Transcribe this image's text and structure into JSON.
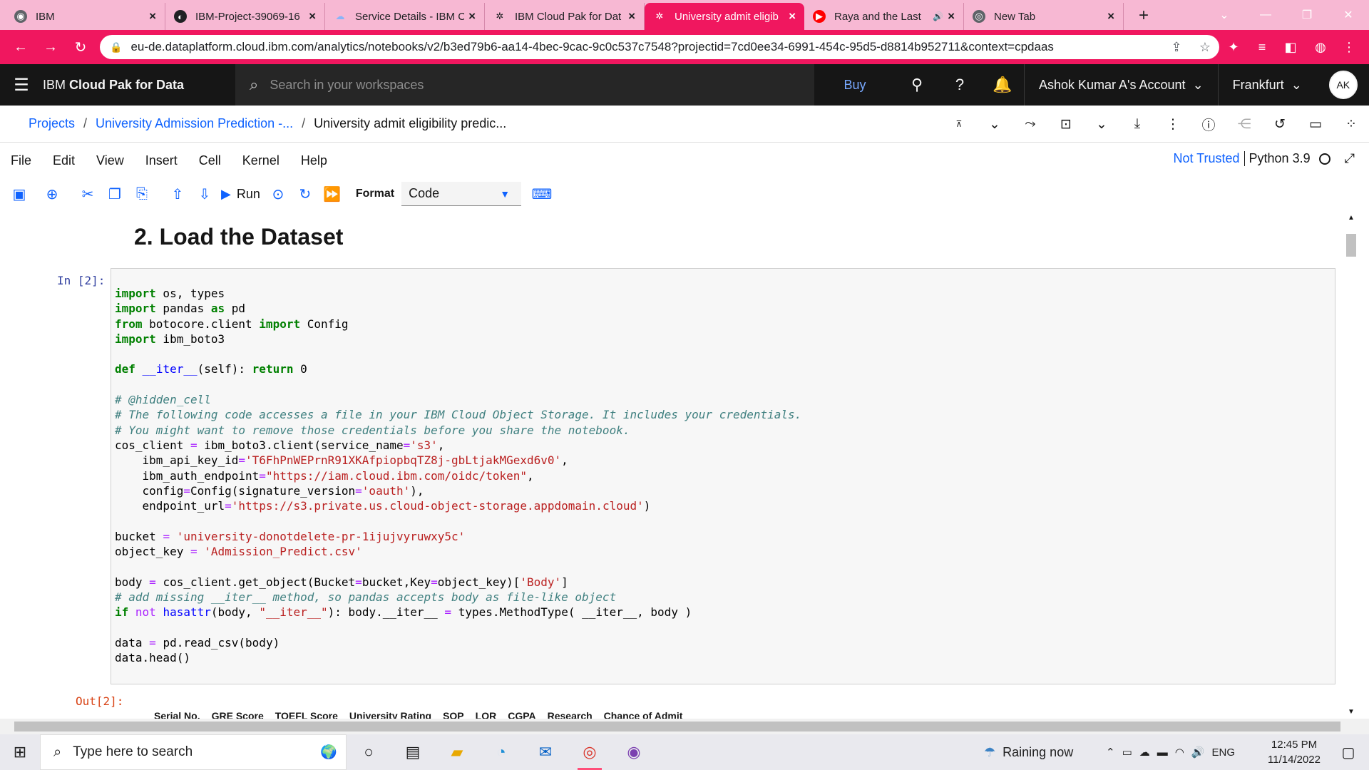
{
  "browser": {
    "tabs": [
      {
        "title": "IBM",
        "icon": "globe-icon",
        "glyph": "◉",
        "fav_bg": "#5f6368",
        "fav_fg": "#ffffff"
      },
      {
        "title": "IBM-Project-39069-16",
        "icon": "github-icon",
        "glyph": "◐",
        "fav_bg": "#202124",
        "fav_fg": "#ffffff"
      },
      {
        "title": "Service Details - IBM C",
        "icon": "cloud-icon",
        "glyph": "☁",
        "fav_bg": "transparent",
        "fav_fg": "#8ab4f8"
      },
      {
        "title": "IBM Cloud Pak for Dat",
        "icon": "ibm-cloudpak-icon",
        "glyph": "✲",
        "fav_bg": "transparent",
        "fav_fg": "#202124"
      },
      {
        "title": "University admit eligib",
        "icon": "ibm-cloudpak-icon",
        "glyph": "✲",
        "fav_bg": "transparent",
        "fav_fg": "#ffffff",
        "active": true
      },
      {
        "title": "Raya and the Last",
        "icon": "youtube-icon",
        "glyph": "▶",
        "fav_bg": "#ff0000",
        "fav_fg": "#ffffff",
        "audio": true
      },
      {
        "title": "New Tab",
        "icon": "chrome-icon",
        "glyph": "◎",
        "fav_bg": "#5f6368",
        "fav_fg": "#ffffff"
      }
    ],
    "url": "eu-de.dataplatform.cloud.ibm.com/analytics/notebooks/v2/b3ed79b6-aa14-4bec-9cac-9c0c537c7548?projectid=7cd0ee34-6991-454c-95d5-d8814b952711&context=cpdaas",
    "accent": "#f0175f",
    "tabstrip_color": "#f7b8d3"
  },
  "header": {
    "brand_prefix": "IBM",
    "brand_name": "Cloud Pak for Data",
    "search_placeholder": "Search in your workspaces",
    "buy_label": "Buy",
    "account_label": "Ashok Kumar A's Account",
    "region_label": "Frankfurt",
    "avatar_initials": "AK"
  },
  "breadcrumb": {
    "projects": "Projects",
    "project": "University Admission Prediction -...",
    "notebook": "University admit eligibility predic..."
  },
  "menu": {
    "items": [
      "File",
      "Edit",
      "View",
      "Insert",
      "Cell",
      "Kernel",
      "Help"
    ],
    "trust": "Not Trusted",
    "kernel": "Python 3.9"
  },
  "toolbar": {
    "run_label": "Run",
    "format_label": "Format",
    "format_value": "Code"
  },
  "notebook": {
    "heading": "2. Load the Dataset",
    "in_prompt": "In [2]:",
    "out_prompt": "Out[2]:",
    "output_columns": [
      "Serial No.",
      "GRE Score",
      "TOEFL Score",
      "University Rating",
      "SOP",
      "LOR",
      "CGPA",
      "Research",
      "Chance of Admit"
    ]
  },
  "taskbar": {
    "search_placeholder": "Type here to search",
    "weather": "Raining now",
    "language": "ENG",
    "time": "12:45 PM",
    "date": "11/14/2022"
  }
}
